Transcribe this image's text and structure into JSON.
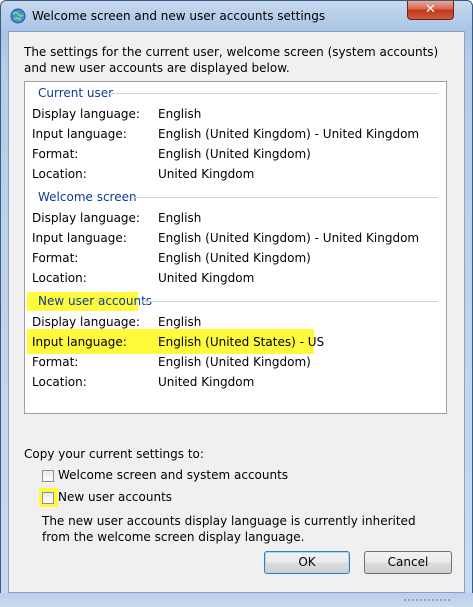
{
  "window": {
    "title": "Welcome screen and new user accounts settings",
    "close_label": "✕"
  },
  "intro": "The settings for the current user, welcome screen (system accounts) and new user accounts are displayed below.",
  "sections": [
    {
      "heading": "Current user",
      "rows": [
        {
          "label": "Display language:",
          "value": "English"
        },
        {
          "label": "Input language:",
          "value": "English (United Kingdom) - United Kingdom"
        },
        {
          "label": "Format:",
          "value": "English (United Kingdom)"
        },
        {
          "label": "Location:",
          "value": "United Kingdom"
        }
      ]
    },
    {
      "heading": "Welcome screen",
      "rows": [
        {
          "label": "Display language:",
          "value": "English"
        },
        {
          "label": "Input language:",
          "value": "English (United Kingdom) - United Kingdom"
        },
        {
          "label": "Format:",
          "value": "English (United Kingdom)"
        },
        {
          "label": "Location:",
          "value": "United Kingdom"
        }
      ]
    },
    {
      "heading": "New user accounts",
      "rows": [
        {
          "label": "Display language:",
          "value": "English"
        },
        {
          "label": "Input language:",
          "value": "English (United States) - US"
        },
        {
          "label": "Format:",
          "value": "English (United Kingdom)"
        },
        {
          "label": "Location:",
          "value": "United Kingdom"
        }
      ]
    }
  ],
  "copy": {
    "label": "Copy your current settings to:",
    "options": [
      {
        "label": "Welcome screen and system accounts",
        "checked": false
      },
      {
        "label": "New user accounts",
        "checked": false
      }
    ],
    "note": "The new user accounts display language is currently inherited from the welcome screen display language."
  },
  "buttons": {
    "ok": "OK",
    "cancel": "Cancel"
  },
  "colors": {
    "highlight": "#fffb3c",
    "section_heading": "#0b3d91"
  }
}
